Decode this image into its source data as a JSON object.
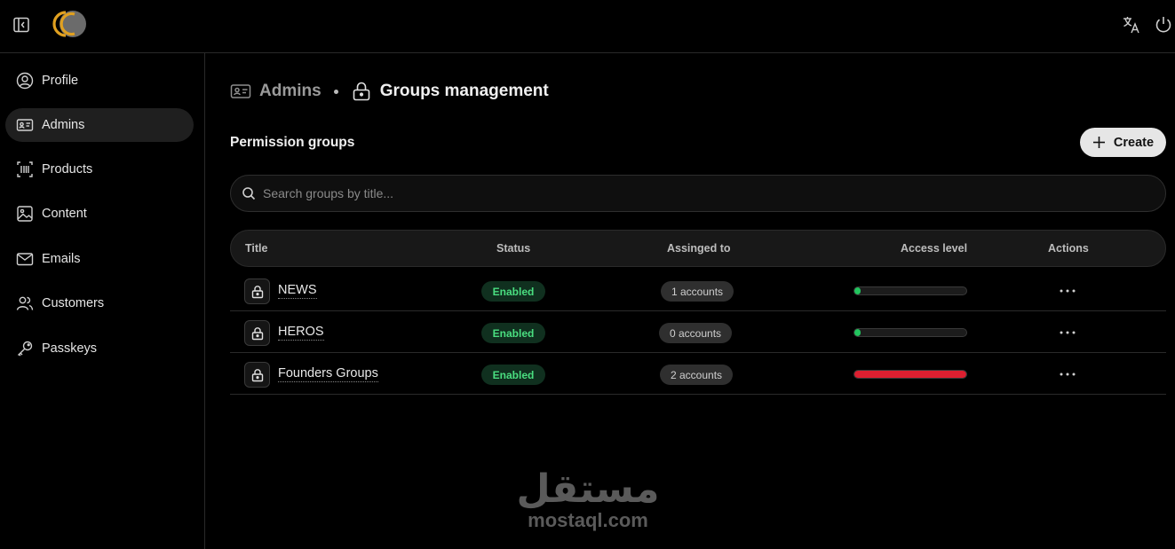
{
  "header": {
    "sidebar_toggle_icon": "sidebar-collapse-icon",
    "logo_colors": {
      "ring": "#e0a020",
      "disc": "#6b6b6b"
    },
    "translate_icon": "translate-icon",
    "power_icon": "power-icon"
  },
  "sidebar": {
    "items": [
      {
        "label": "Profile",
        "icon": "user-circle-icon",
        "active": false
      },
      {
        "label": "Admins",
        "icon": "id-card-icon",
        "active": true
      },
      {
        "label": "Products",
        "icon": "barcode-icon",
        "active": false
      },
      {
        "label": "Content",
        "icon": "image-icon",
        "active": false
      },
      {
        "label": "Emails",
        "icon": "mail-icon",
        "active": false
      },
      {
        "label": "Customers",
        "icon": "users-icon",
        "active": false
      },
      {
        "label": "Passkeys",
        "icon": "key-icon",
        "active": false
      }
    ]
  },
  "breadcrumb": {
    "parent": "Admins",
    "current": "Groups management"
  },
  "section": {
    "title": "Permission groups",
    "create_label": "Create"
  },
  "search": {
    "placeholder": "Search groups by title..."
  },
  "table": {
    "columns": {
      "title": "Title",
      "status": "Status",
      "assigned": "Assinged to",
      "access": "Access level",
      "actions": "Actions"
    },
    "rows": [
      {
        "title": "NEWS",
        "status": "Enabled",
        "accounts": "1 accounts",
        "access_level": 0.04,
        "access_color": "#22c55e"
      },
      {
        "title": "HEROS",
        "status": "Enabled",
        "accounts": "0 accounts",
        "access_level": 0.04,
        "access_color": "#22c55e"
      },
      {
        "title": "Founders Groups",
        "status": "Enabled",
        "accounts": "2 accounts",
        "access_level": 1.0,
        "access_color": "#dc1f30"
      }
    ]
  },
  "watermark": {
    "arabic": "مستقل",
    "latin": "mostaql.com"
  },
  "colors": {
    "status_enabled_text": "#4ade80",
    "status_enabled_bg": "#10301f",
    "accent_red": "#dc1f30",
    "accent_green": "#22c55e"
  }
}
